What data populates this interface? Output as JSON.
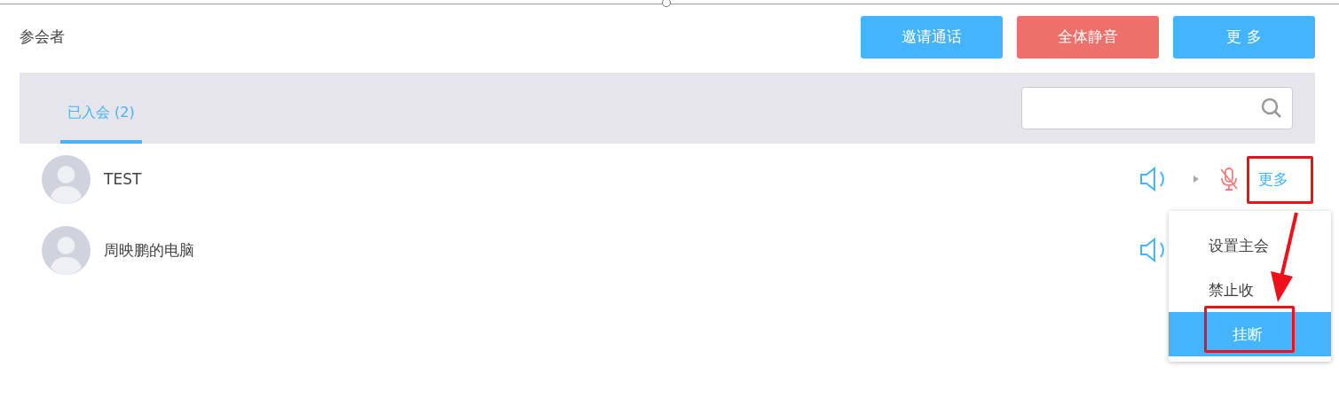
{
  "title": "参会者",
  "buttons": [
    {
      "label": "邀请通话",
      "kind": "primary"
    },
    {
      "label": "全体静音",
      "kind": "danger"
    },
    {
      "label": "更 多",
      "kind": "primary"
    }
  ],
  "tabs": [
    {
      "label": "已入会 (2)",
      "selected": true
    }
  ],
  "participants": [
    {
      "name": "TEST",
      "mic_muted": true,
      "more": "更多"
    },
    {
      "name": "周映鹏的电脑"
    }
  ],
  "menu": {
    "items": [
      {
        "label": "设置主会",
        "selected": false
      },
      {
        "label": "禁止收",
        "selected": false
      },
      {
        "label": "挂断",
        "selected": true
      }
    ]
  }
}
